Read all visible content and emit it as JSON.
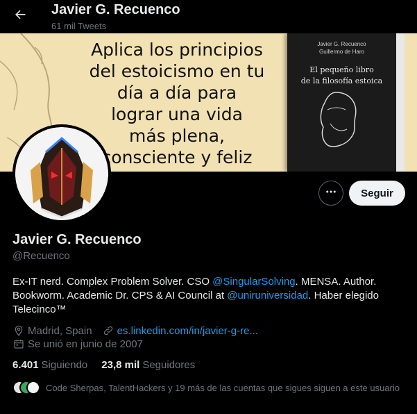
{
  "header": {
    "title": "Javier G. Recuenco",
    "subtitle": "61 mil Tweets"
  },
  "banner": {
    "lines": [
      "Aplica los principios",
      "del estoicismo en tu",
      "día a día para",
      "lograr una vida",
      "más plena,",
      "consciente y feliz"
    ],
    "book_authors": [
      "Javier G. Recuenco",
      "Guillermo de Haro"
    ],
    "book_title_lines": [
      "El pequeño libro",
      "de la filosofía estoica"
    ]
  },
  "actions": {
    "more_icon": "ellipsis-icon",
    "follow_label": "Seguir"
  },
  "profile": {
    "name": "Javier G. Recuenco",
    "handle": "@Recuenco",
    "bio": {
      "part1": "Ex-IT nerd. Complex Problem Solver. CSO ",
      "mention1": "@SingularSolving",
      "part2": ". MENSA. Author. Bookworm. Academic Dr. CPS & AI Council at ",
      "mention2": "@uniruniversidad",
      "part3": ". Haber elegido Telecinco™"
    },
    "location": "Madrid, Spain",
    "website": "es.linkedin.com/in/javier-g-re...",
    "joined": "Se unió en junio de 2007"
  },
  "stats": {
    "following_count": "6.401",
    "following_label": "Siguiendo",
    "followers_count": "23,8 mil",
    "followers_label": "Seguidores"
  },
  "followers_you_know": "Code Sherpas, TalentHackers y 19 más de las cuentas que sigues siguen a este usuario",
  "colors": {
    "accent": "#1d9bf0",
    "secondary_text": "#71767b",
    "primary_text": "#e7e9ea",
    "banner_bg": "#f2e2b3"
  }
}
